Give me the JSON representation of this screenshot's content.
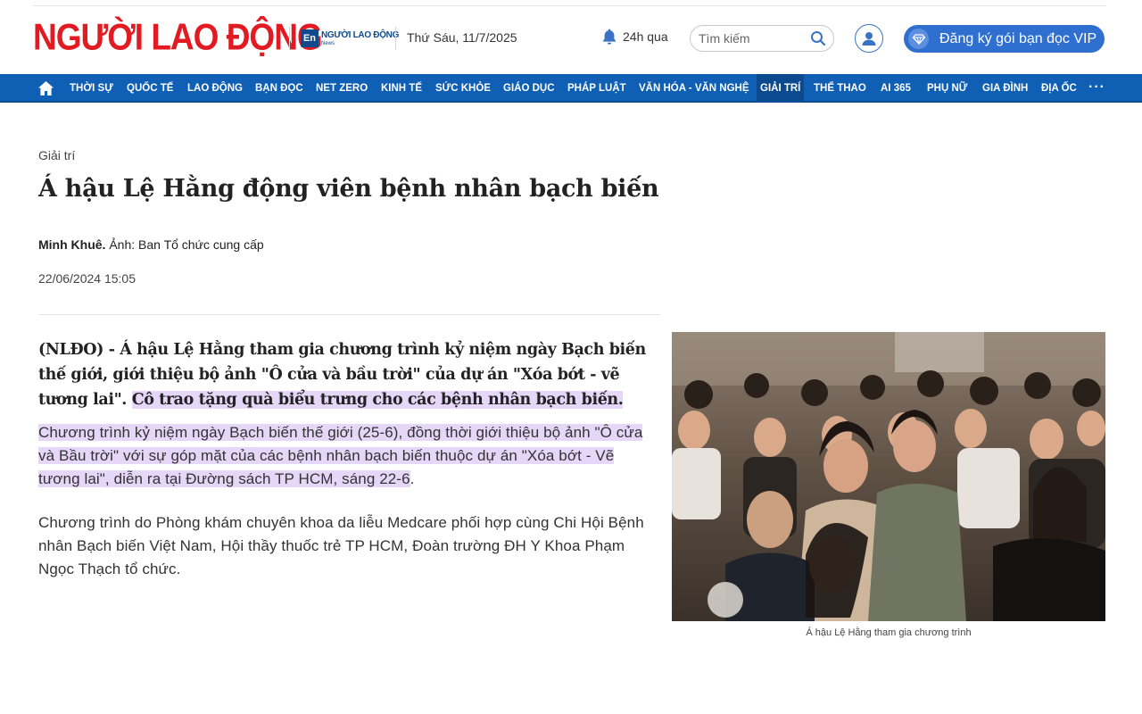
{
  "header": {
    "logo_text": "NGƯỜI LAO ĐỘNG",
    "en_logo": {
      "badge": "En",
      "title": "NGƯỜI LAO ĐỘNG",
      "subtitle": "News"
    },
    "date": "Thứ Sáu, 11/7/2025",
    "news_24h": "24h qua",
    "search_placeholder": "Tìm kiếm",
    "vip_button": "Đăng ký gói bạn đọc VIP"
  },
  "nav": {
    "items": [
      {
        "label": "THỜI SỰ"
      },
      {
        "label": "QUỐC TẾ"
      },
      {
        "label": "LAO ĐỘNG"
      },
      {
        "label": "BẠN ĐỌC"
      },
      {
        "label": "NET ZERO"
      },
      {
        "label": "KINH TẾ"
      },
      {
        "label": "SỨC KHỎE"
      },
      {
        "label": "GIÁO DỤC"
      },
      {
        "label": "PHÁP LUẬT"
      },
      {
        "label": "VĂN HÓA - VĂN NGHỆ"
      },
      {
        "label": "GIẢI TRÍ",
        "active": true
      },
      {
        "label": "THỂ THAO"
      },
      {
        "label": "AI 365"
      },
      {
        "label": "PHỤ NỮ"
      },
      {
        "label": "GIA ĐÌNH"
      },
      {
        "label": "ĐỊA ỐC"
      }
    ],
    "more": "···"
  },
  "article": {
    "category": "Giải trí",
    "title": "Á hậu Lệ Hằng động viên bệnh nhân bạch biến",
    "author": "Minh Khuê.",
    "photo_credit": "Ảnh: Ban Tổ chức cung cấp",
    "published": "22/06/2024 15:05",
    "lead_plain": "(NLĐO) - Á hậu Lệ Hằng tham gia chương trình kỷ niệm ngày Bạch biến thế giới, giới thiệu bộ ảnh \"Ô cửa và bầu trời\" của dự án \"Xóa bớt - vẽ tương lai\".",
    "lead_highlight": "Cô trao tặng quà biểu trưng cho các bệnh nhân bạch biến.",
    "para1_highlight": "Chương trình kỷ niệm ngày Bạch biến thế giới (25-6), đồng thời giới thiệu bộ ảnh \"Ô cửa và Bầu trời\" với sự góp mặt của các bệnh nhân bạch biến thuộc dự án \"Xóa bớt - Vẽ tương lai\", diễn ra tại Đường sách TP HCM, sáng 22-6",
    "para1_tail": ".",
    "para2": "Chương trình do Phòng khám chuyên khoa da liễu Medcare phối hợp cùng Chi Hội Bệnh nhân Bạch biến Việt Nam, Hội thầy thuốc trẻ TP HCM, Đoàn trường ĐH Y Khoa Phạm Ngọc Thạch tổ chức.",
    "photo_caption": "Á hậu Lệ Hằng tham gia chương trình"
  },
  "colors": {
    "brand_red": "#e21b22",
    "nav_blue": "#0f5fb5",
    "vip_blue": "#2f6fd0",
    "highlight": "#e6d6f7"
  }
}
